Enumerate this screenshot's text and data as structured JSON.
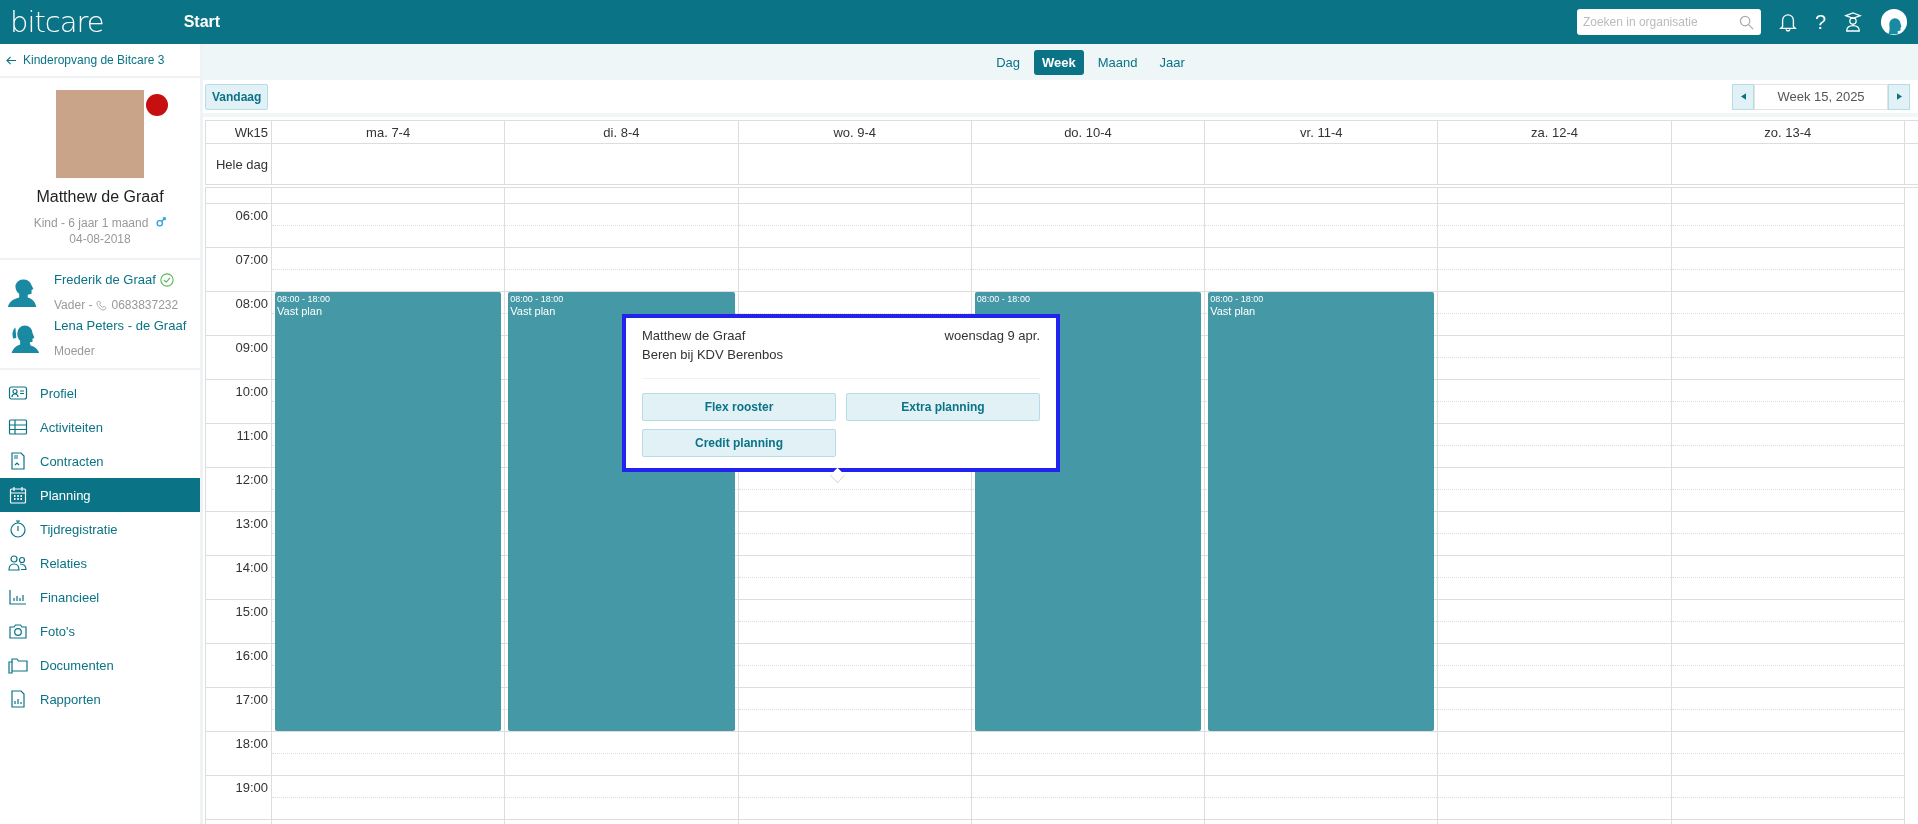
{
  "top_bar": {
    "logo": "bitcare",
    "title": "Start",
    "search": {
      "placeholder": "Zoeken in organisatie"
    },
    "help": "?"
  },
  "sidebar": {
    "back_link": "Kinderopvang de Bitcare 3",
    "child": {
      "name": "Matthew de Graaf",
      "info": "Kind - 6 jaar 1 maand",
      "birth_date": "04-08-2018"
    },
    "parents": [
      {
        "name": "Frederik de Graaf",
        "verified": true,
        "role": "Vader -",
        "phone": "0683837232",
        "kind": "male"
      },
      {
        "name": "Lena Peters - de Graaf",
        "verified": false,
        "role": "Moeder",
        "kind": "female"
      }
    ],
    "nav": [
      {
        "label": "Profiel",
        "kind": "profile",
        "selected": false
      },
      {
        "label": "Activiteiten",
        "kind": "table",
        "selected": false
      },
      {
        "label": "Contracten",
        "kind": "contract",
        "selected": false
      },
      {
        "label": "Planning",
        "kind": "calendar",
        "selected": true
      },
      {
        "label": "Tijdregistratie",
        "kind": "stopwatch",
        "selected": false
      },
      {
        "label": "Relaties",
        "kind": "people",
        "selected": false
      },
      {
        "label": "Financieel",
        "kind": "chart",
        "selected": false
      },
      {
        "label": "Foto's",
        "kind": "camera",
        "selected": false
      },
      {
        "label": "Documenten",
        "kind": "folder",
        "selected": false
      },
      {
        "label": "Rapporten",
        "kind": "report",
        "selected": false
      }
    ]
  },
  "view_tabs": [
    {
      "label": "Dag",
      "selected": false
    },
    {
      "label": "Week",
      "selected": true
    },
    {
      "label": "Maand",
      "selected": false
    },
    {
      "label": "Jaar",
      "selected": false
    }
  ],
  "toolbar": {
    "today_button": "Vandaag",
    "week_label": "Week 15, 2025"
  },
  "calendar": {
    "week": "Wk15",
    "all_day_label": "Hele dag",
    "days": [
      {
        "label": "ma. 7-4",
        "events": [
          {
            "time": "08:00 - 18:00",
            "title": "Vast plan"
          }
        ]
      },
      {
        "label": "di. 8-4",
        "events": [
          {
            "time": "08:00 - 18:00",
            "title": "Vast plan"
          }
        ]
      },
      {
        "label": "wo. 9-4"
      },
      {
        "label": "do. 10-4",
        "events": [
          {
            "time": "08:00 - 18:00"
          }
        ]
      },
      {
        "label": "vr. 11-4",
        "events": [
          {
            "time": "08:00 - 18:00",
            "title": "Vast plan"
          }
        ]
      },
      {
        "label": "za. 12-4"
      },
      {
        "label": "zo. 13-4"
      }
    ],
    "hours": [
      "06:00",
      "07:00",
      "08:00",
      "09:00",
      "10:00",
      "11:00",
      "12:00",
      "13:00",
      "14:00",
      "15:00",
      "16:00",
      "17:00",
      "18:00",
      "19:00"
    ]
  },
  "popup": {
    "name": "Matthew de Graaf",
    "date": "woensdag 9 apr.",
    "group": "Beren bij KDV Berenbos",
    "buttons": [
      "Flex rooster",
      "Extra planning",
      "Credit planning"
    ]
  }
}
